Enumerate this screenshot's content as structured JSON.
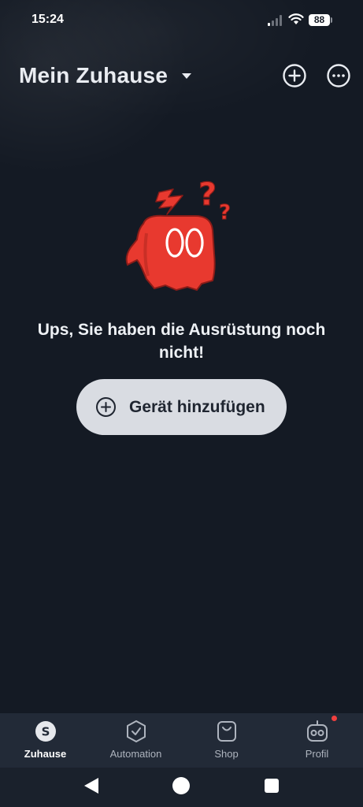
{
  "status_bar": {
    "time": "15:24",
    "battery": "88",
    "icons": [
      "signal-icon",
      "wifi-icon",
      "battery-icon"
    ]
  },
  "header": {
    "title": "Mein Zuhause",
    "icons": [
      "caret-down-icon",
      "plus-circle-icon",
      "more-circle-icon"
    ]
  },
  "empty_state": {
    "message": "Ups, Sie haben die Ausrüstung noch nicht!",
    "illustration": "confused-red-mascot",
    "button_label": "Gerät hinzufügen",
    "button_icon": "plus-circle-icon"
  },
  "tab_bar": {
    "tabs": [
      {
        "label": "Zuhause",
        "icon": "home-s-icon",
        "active": true
      },
      {
        "label": "Automation",
        "icon": "shield-check-icon",
        "active": false
      },
      {
        "label": "Shop",
        "icon": "shopping-bag-icon",
        "active": false
      },
      {
        "label": "Profil",
        "icon": "robot-icon",
        "active": false,
        "notification_dot": true
      }
    ]
  },
  "colors": {
    "background": "#141a24",
    "tab_bar": "#222a37",
    "button_bg": "#d9dce2",
    "mascot_red": "#e8392f",
    "badge_red": "#f0403f"
  }
}
